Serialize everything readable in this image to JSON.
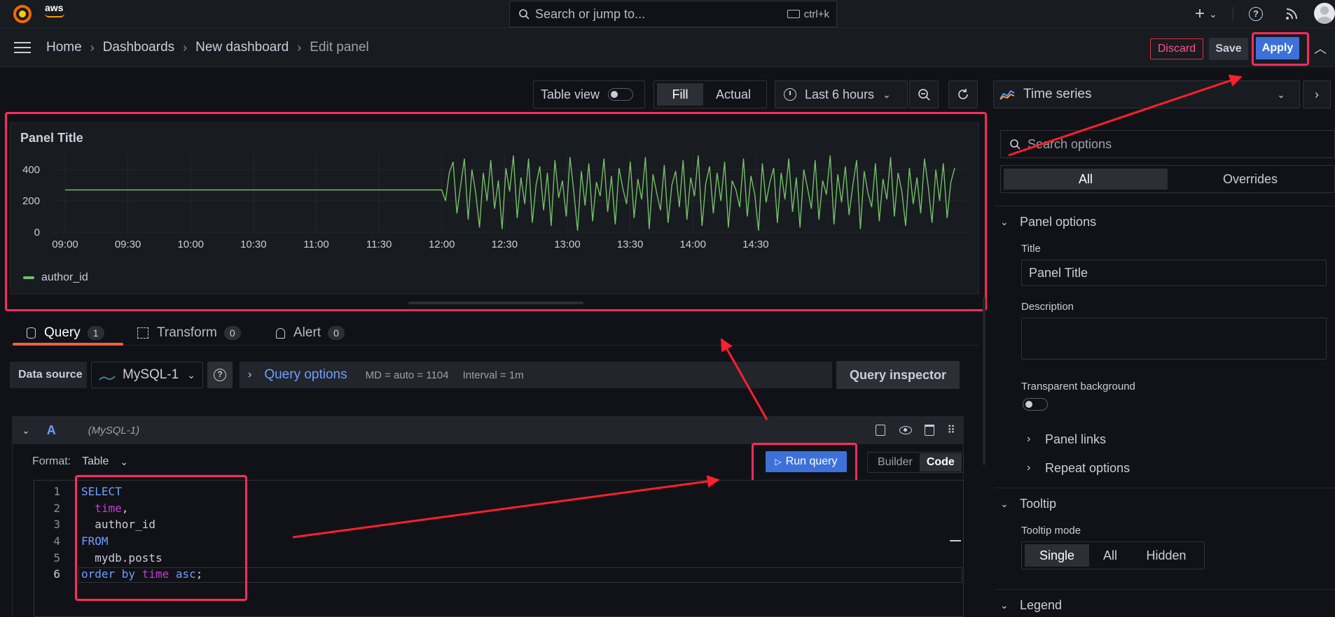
{
  "topbar": {
    "brand": "aws",
    "search_placeholder": "Search or jump to...",
    "search_shortcut": "ctrl+k",
    "plus": "+"
  },
  "navbar": {
    "breadcrumbs": [
      "Home",
      "Dashboards",
      "New dashboard",
      "Edit panel"
    ],
    "discard": "Discard",
    "save": "Save",
    "apply": "Apply"
  },
  "toolbar": {
    "table_view": "Table view",
    "fill": "Fill",
    "actual": "Actual",
    "time_range": "Last 6 hours"
  },
  "panel": {
    "title": "Panel Title",
    "legend": "author_id"
  },
  "chart_data": {
    "type": "line",
    "title": "Panel Title",
    "x_ticks": [
      "09:00",
      "09:30",
      "10:00",
      "10:30",
      "11:00",
      "11:30",
      "12:00",
      "12:30",
      "13:00",
      "13:30",
      "14:00",
      "14:30"
    ],
    "y_ticks": [
      "0",
      "200",
      "400"
    ],
    "ylim": [
      0,
      500
    ],
    "grid": true,
    "legend": "bottom-left",
    "series": [
      {
        "name": "author_id",
        "color": "#73bf69",
        "flat_value": 270,
        "flat_range": [
          "09:00",
          "12:00"
        ],
        "values_after_1200": [
          200,
          380,
          450,
          120,
          300,
          470,
          80,
          400,
          250,
          30,
          380,
          200,
          460,
          150,
          330,
          20,
          410,
          260,
          490,
          90,
          350,
          180,
          470,
          60,
          300,
          420,
          140,
          380,
          40,
          460,
          220,
          330,
          100,
          480,
          260,
          10,
          390,
          170,
          440,
          70,
          320,
          230,
          470,
          130,
          360,
          50,
          410,
          280,
          180,
          450,
          90,
          340,
          210,
          480,
          20,
          370,
          250,
          140,
          430,
          60,
          300,
          390,
          160,
          460,
          80,
          350,
          230,
          490,
          40,
          310,
          420,
          120,
          380,
          200,
          450,
          30,
          330,
          270,
          160,
          470,
          100,
          360,
          240,
          10,
          440,
          190,
          320,
          410,
          60,
          380,
          210,
          470,
          130,
          350,
          30,
          400,
          280,
          150,
          460,
          80,
          330,
          240,
          490,
          50,
          370,
          190,
          420,
          110,
          300,
          460,
          20,
          390,
          250,
          160,
          440,
          70,
          340,
          210,
          480,
          100,
          380,
          260,
          40,
          410,
          180,
          350,
          120,
          470,
          290,
          60,
          400,
          200,
          440,
          90,
          320,
          410
        ]
      }
    ]
  },
  "query_tabs": [
    {
      "label": "Query",
      "count": "1"
    },
    {
      "label": "Transform",
      "count": "0"
    },
    {
      "label": "Alert",
      "count": "0"
    }
  ],
  "query_row": {
    "data_source_label": "Data source",
    "data_source": "MySQL-1",
    "query_options": "Query options",
    "md": "MD = auto = 1104",
    "interval": "Interval = 1m",
    "inspector": "Query inspector"
  },
  "query_a": {
    "letter": "A",
    "source": "(MySQL-1)",
    "format_label": "Format:",
    "format_value": "Table",
    "run_query": "Run query",
    "builder": "Builder",
    "code": "Code"
  },
  "code_lines": [
    {
      "n": "1",
      "parts": [
        {
          "t": "SELECT",
          "c": "kw"
        }
      ]
    },
    {
      "n": "2",
      "parts": [
        {
          "t": "  ",
          "c": "pl"
        },
        {
          "t": "time",
          "c": "fn"
        },
        {
          "t": ",",
          "c": "pl"
        }
      ]
    },
    {
      "n": "3",
      "parts": [
        {
          "t": "  author_id",
          "c": "pl"
        }
      ]
    },
    {
      "n": "4",
      "parts": [
        {
          "t": "FROM",
          "c": "kw"
        }
      ]
    },
    {
      "n": "5",
      "parts": [
        {
          "t": "  mydb.posts",
          "c": "pl"
        }
      ]
    },
    {
      "n": "6",
      "parts": [
        {
          "t": "order by ",
          "c": "kw"
        },
        {
          "t": "time",
          "c": "fn"
        },
        {
          "t": " asc",
          "c": "kw"
        },
        {
          "t": ";",
          "c": "pl"
        }
      ]
    }
  ],
  "options": {
    "viz": "Time series",
    "search_placeholder": "Search options",
    "all": "All",
    "overrides": "Overrides",
    "panel_options": "Panel options",
    "title_label": "Title",
    "title_value": "Panel Title",
    "description_label": "Description",
    "transparent_label": "Transparent background",
    "panel_links": "Panel links",
    "repeat_options": "Repeat options",
    "tooltip": "Tooltip",
    "tooltip_mode": "Tooltip mode",
    "tooltip_single": "Single",
    "tooltip_all": "All",
    "tooltip_hidden": "Hidden",
    "legend": "Legend"
  },
  "colors": {
    "accent_blue": "#3d71d9",
    "annotation_red": "#ff2a5f",
    "series_green": "#73bf69"
  }
}
